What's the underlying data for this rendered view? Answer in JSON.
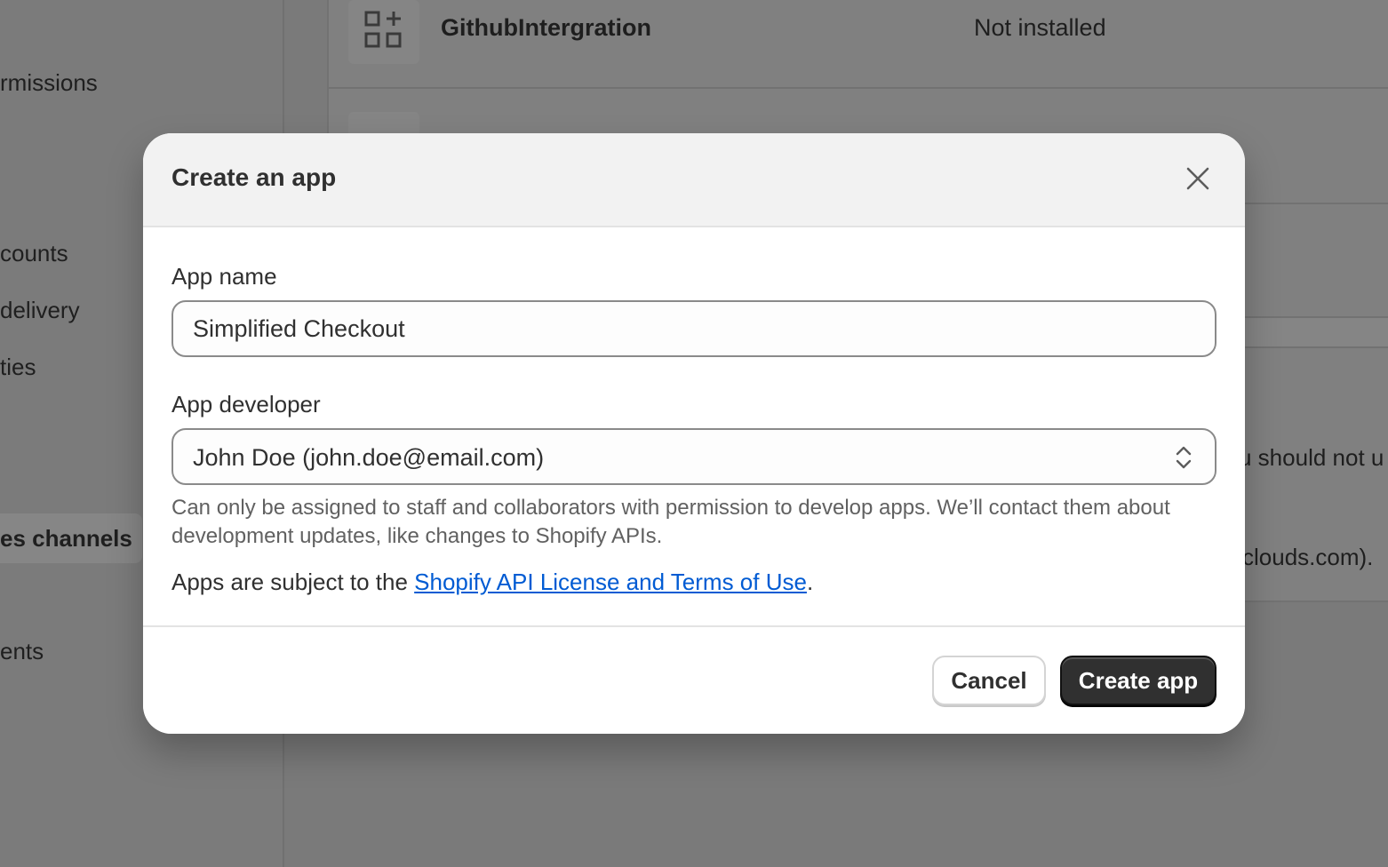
{
  "background": {
    "sidebar": {
      "items": [
        {
          "label": "rmissions"
        },
        {
          "label": "counts"
        },
        {
          "label": "delivery"
        },
        {
          "label": "ties"
        },
        {
          "label": "es channels"
        },
        {
          "label": "ents"
        }
      ]
    },
    "app_list": {
      "row1_name": "GithubIntergration",
      "row1_status": "Not installed"
    },
    "right_text": {
      "line1": "u should not u",
      "line2": "clouds.com)."
    }
  },
  "modal": {
    "title": "Create an app",
    "close_icon": "close-icon",
    "app_name": {
      "label": "App name",
      "value": "Simplified Checkout"
    },
    "app_developer": {
      "label": "App developer",
      "selected": "John Doe (john.doe@email.com)",
      "help_text": "Can only be assigned to staff and collaborators with permission to develop apps. We’ll contact them about development updates, like changes to Shopify APIs."
    },
    "terms": {
      "prefix": "Apps are subject to the ",
      "link_text": "Shopify API License and Terms of Use",
      "suffix": "."
    },
    "footer": {
      "cancel_label": "Cancel",
      "create_label": "Create app"
    }
  },
  "colors": {
    "overlay": "#7a7a7a",
    "primary_button": "#303030",
    "link": "#005bd3"
  }
}
